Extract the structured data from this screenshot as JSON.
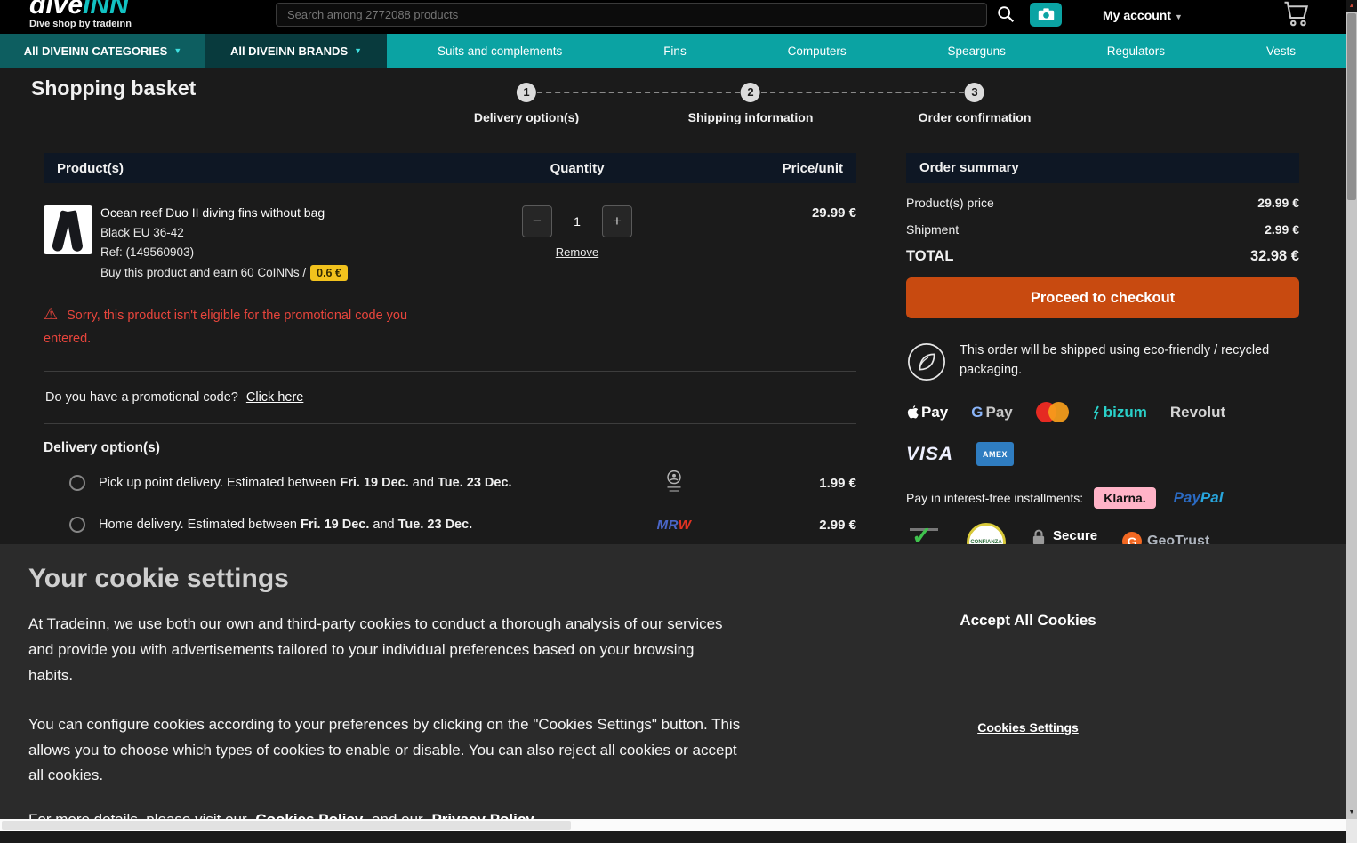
{
  "header": {
    "logo_part1": "dive",
    "logo_part2": "INN",
    "tagline": "Dive shop by tradeinn",
    "search_placeholder": "Search among 2772088 products",
    "account_label": "My account"
  },
  "nav": {
    "categories_label": "All DIVEINN CATEGORIES",
    "brands_label": "All DIVEINN BRANDS",
    "items": [
      "Suits and complements",
      "Fins",
      "Computers",
      "Spearguns",
      "Regulators",
      "Vests"
    ]
  },
  "page": {
    "title": "Shopping basket",
    "steps": [
      {
        "num": "1",
        "label": "Delivery option(s)"
      },
      {
        "num": "2",
        "label": "Shipping information"
      },
      {
        "num": "3",
        "label": "Order confirmation"
      }
    ]
  },
  "basket": {
    "header": {
      "product": "Product(s)",
      "quantity": "Quantity",
      "price": "Price/unit"
    },
    "item": {
      "name": "Ocean reef Duo II diving fins without bag",
      "variant": "Black EU 36-42",
      "ref": "Ref: (149560903)",
      "coinns_text": "Buy this product and earn 60 CoINNs /",
      "coinns_badge": "0.6 €",
      "minus": "−",
      "quantity": "1",
      "plus": "+",
      "remove": "Remove",
      "price": "29.99 €"
    },
    "warning": "Sorry, this product isn't eligible for the promotional code you entered.",
    "promo_text": "Do you have a promotional code?",
    "promo_link": "Click here",
    "delivery_title": "Delivery option(s)",
    "delivery_options": [
      {
        "prefix": "Pick up point delivery. Estimated between",
        "date1": "Fri. 19 Dec.",
        "conj": "and",
        "date2": "Tue. 23 Dec.",
        "price": "1.99 €"
      },
      {
        "prefix": "Home delivery. Estimated between",
        "date1": "Fri. 19 Dec.",
        "conj": "and",
        "date2": "Tue. 23 Dec.",
        "price": "2.99 €",
        "carrier_part1": "MR",
        "carrier_part2": "W"
      }
    ]
  },
  "summary": {
    "title": "Order summary",
    "rows": [
      {
        "label": "Product(s) price",
        "value": "29.99 €"
      },
      {
        "label": "Shipment",
        "value": "2.99 €"
      }
    ],
    "total_label": "TOTAL",
    "total_value": "32.98 €",
    "checkout_label": "Proceed to checkout",
    "eco_text": "This order will be shipped using eco-friendly / recycled packaging.",
    "installments_label": "Pay in interest-free installments:",
    "payments": {
      "apple_pay": "Pay",
      "gpay_g": "G",
      "gpay_text": "Pay",
      "bizum": "bizum",
      "revolut": "Revolut",
      "visa": "VISA",
      "amex": "AMEX",
      "klarna": "Klarna.",
      "paypal_1": "Pay",
      "paypal_2": "Pal"
    },
    "trust": {
      "confianza": "CONFIANZA",
      "secure": "Secure",
      "geotrust_g": "G",
      "geotrust": "GeoTrust"
    }
  },
  "cookies": {
    "title": "Your cookie settings",
    "p1": "At Tradeinn, we use both our own and third-party cookies to conduct a thorough analysis of our services and provide you with advertisements tailored to your individual preferences based on your browsing habits.",
    "p2": "You can configure cookies according to your preferences by clicking on the \"Cookies Settings\" button. This allows you to choose which types of cookies to enable or disable. You can also reject all cookies or accept all cookies.",
    "more_prefix": "For more details, please visit our",
    "cookies_policy": "Cookies Policy",
    "and_our": "and our",
    "privacy_policy": "Privacy Policy",
    "accept_all": "Accept All Cookies",
    "settings": "Cookies Settings"
  },
  "colors": {
    "teal_accent": "#0ba3a3",
    "checkout_orange": "#c84a10",
    "warning_red": "#e8453c",
    "coinns_yellow": "#f2c21d",
    "klarna_pink": "#ffb3c7"
  },
  "icons": {
    "search-icon": "magnifier",
    "camera-icon": "image search camera",
    "cart-icon": "shopping cart",
    "warning-icon": "red alert triangle",
    "eco-icon": "leaf in circle",
    "pickup-point-icon": "pickup point person",
    "lock-icon": "secure padlock",
    "mastercard-icon": "red and orange circles"
  }
}
